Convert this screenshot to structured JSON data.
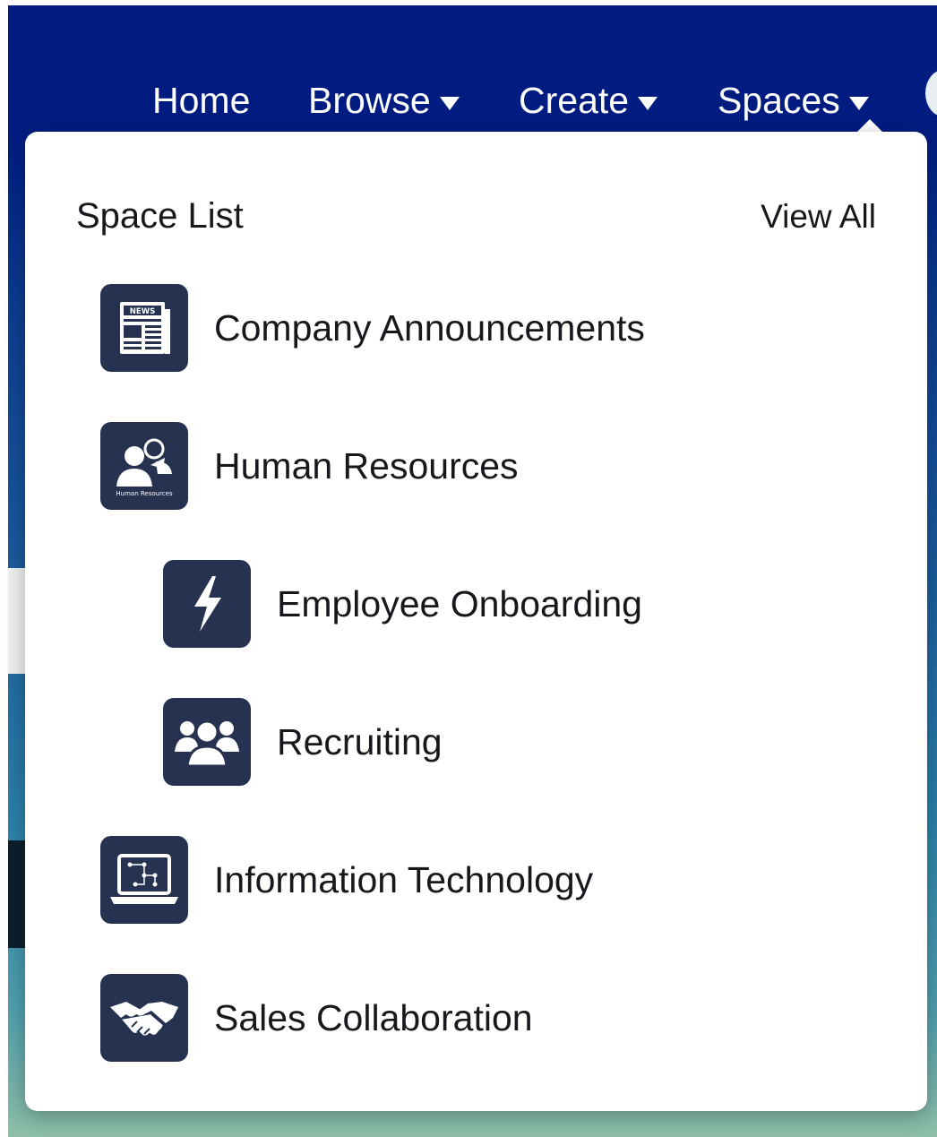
{
  "nav": {
    "items": [
      {
        "label": "Home",
        "has_dropdown": false
      },
      {
        "label": "Browse",
        "has_dropdown": true
      },
      {
        "label": "Create",
        "has_dropdown": true
      },
      {
        "label": "Spaces",
        "has_dropdown": true
      }
    ]
  },
  "dropdown": {
    "title": "Space List",
    "view_all": "View All",
    "spaces": [
      {
        "label": "Company Announcements",
        "icon": "newspaper-icon",
        "icon_text": "NEWS",
        "level": 0
      },
      {
        "label": "Human Resources",
        "icon": "human-resources-icon",
        "icon_text": "Human Resources",
        "level": 0
      },
      {
        "label": "Employee Onboarding",
        "icon": "lightning-bolt-icon",
        "level": 1
      },
      {
        "label": "Recruiting",
        "icon": "group-icon",
        "level": 1
      },
      {
        "label": "Information Technology",
        "icon": "laptop-diagram-icon",
        "level": 0
      },
      {
        "label": "Sales Collaboration",
        "icon": "handshake-icon",
        "level": 0
      }
    ]
  },
  "colors": {
    "header_bg": "#001c80",
    "icon_bg": "#263250",
    "text": "#16181c"
  }
}
